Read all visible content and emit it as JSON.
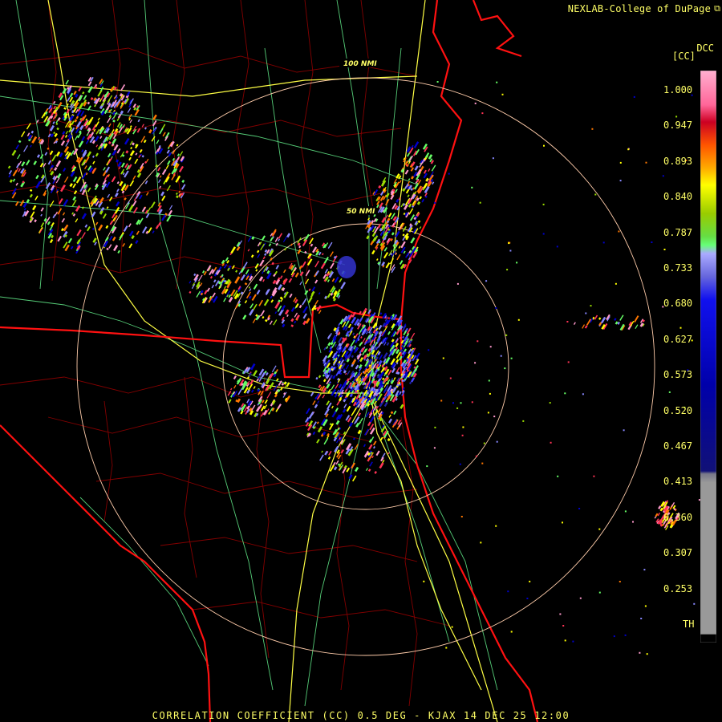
{
  "credit": "NEXLAB-College of DuPage",
  "credit_icon": "external-link-icon",
  "product_code": "DCC",
  "units": "[CC]",
  "footer": "CORRELATION COEFFICIENT (CC) 0.5 DEG - KJAX 14 DEC 25 12:00",
  "range_rings": [
    {
      "label": "50 NMI"
    },
    {
      "label": "100 NMI"
    }
  ],
  "legend": {
    "ticks": [
      "1.000",
      "0.947",
      "0.893",
      "0.840",
      "0.787",
      "0.733",
      "0.680",
      "0.627",
      "0.573",
      "0.520",
      "0.467",
      "0.413",
      "0.360",
      "0.307",
      "0.253",
      "TH"
    ],
    "colors": [
      "#ff99cc",
      "#ff3355",
      "#ff7700",
      "#ffff00",
      "#99dd00",
      "#66ff66",
      "#8888ff",
      "#0000cc",
      "#2222aa",
      "#999999",
      "#000000"
    ]
  },
  "colors": {
    "state_border": "#ff1111",
    "county_border": "#990000",
    "highway": "#ffff55",
    "road": "#66dd88",
    "range_ring": "#ffccaa",
    "text": "#ffff66"
  }
}
